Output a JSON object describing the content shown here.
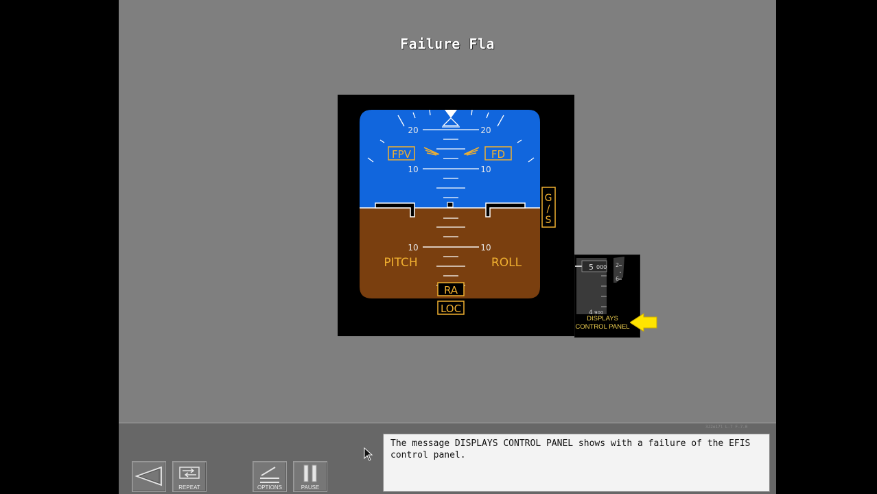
{
  "screen": {
    "title": "Failure Fla"
  },
  "pfd": {
    "pitch_labels": {
      "upper20_left": "20",
      "upper20_right": "20",
      "upper10_left": "10",
      "upper10_right": "10",
      "lower10_left": "10",
      "lower10_right": "10"
    },
    "flags": {
      "fpv": "FPV",
      "fd": "FD",
      "gs": "G/S",
      "pitch": "PITCH",
      "roll": "ROLL",
      "ra": "RA",
      "loc": "LOC"
    },
    "colors": {
      "sky": "#1166dd",
      "ground": "#7a3f0f",
      "flag_amber": "#f0b030",
      "scale_white": "#ffffff"
    }
  },
  "dcp": {
    "tape_values": {
      "alt_top": "5000",
      "alt_bottom": "4900",
      "vs_top": "2",
      "vs_bottom": "6"
    },
    "label_line1": "DISPLAYS",
    "label_line2": "CONTROL PANEL",
    "arrow_color": "#ffe400"
  },
  "controls": {
    "back_label": "",
    "repeat_label": "REPEAT",
    "options_label": "OPTIONS",
    "pause_label": "PAUSE"
  },
  "message": {
    "text": "The message DISPLAYS CONTROL PANEL shows with a failure of the EFIS control panel."
  },
  "footer": {
    "version": "3J2e17l   L-7 F-7.0"
  }
}
